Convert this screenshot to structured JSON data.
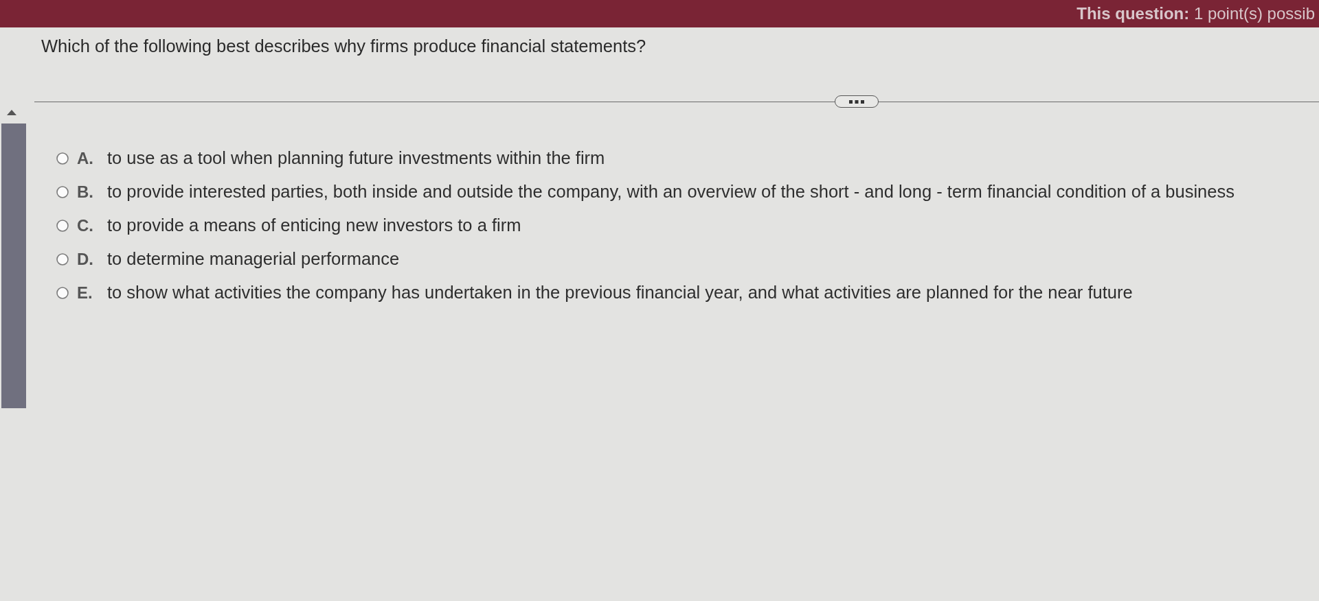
{
  "header": {
    "text": "**This question:** 1 point(s) possib"
  },
  "question": {
    "text": "Which of the following best describes why firms produce financial statements?"
  },
  "options": [
    {
      "letter": "A.",
      "text": "to use as a tool when planning future investments within the firm",
      "selected": false
    },
    {
      "letter": "B.",
      "text": "to provide interested parties, both inside and outside the company, with an overview of the short -  and long - term financial condition of a business",
      "selected": false
    },
    {
      "letter": "C.",
      "text": "to provide a means of enticing new investors to a firm",
      "selected": false
    },
    {
      "letter": "D.",
      "text": "to determine managerial performance",
      "selected": false
    },
    {
      "letter": "E.",
      "text": "to show what activities the company has undertaken in the previous financial year, and what activities are planned for the near future",
      "selected": false
    }
  ]
}
